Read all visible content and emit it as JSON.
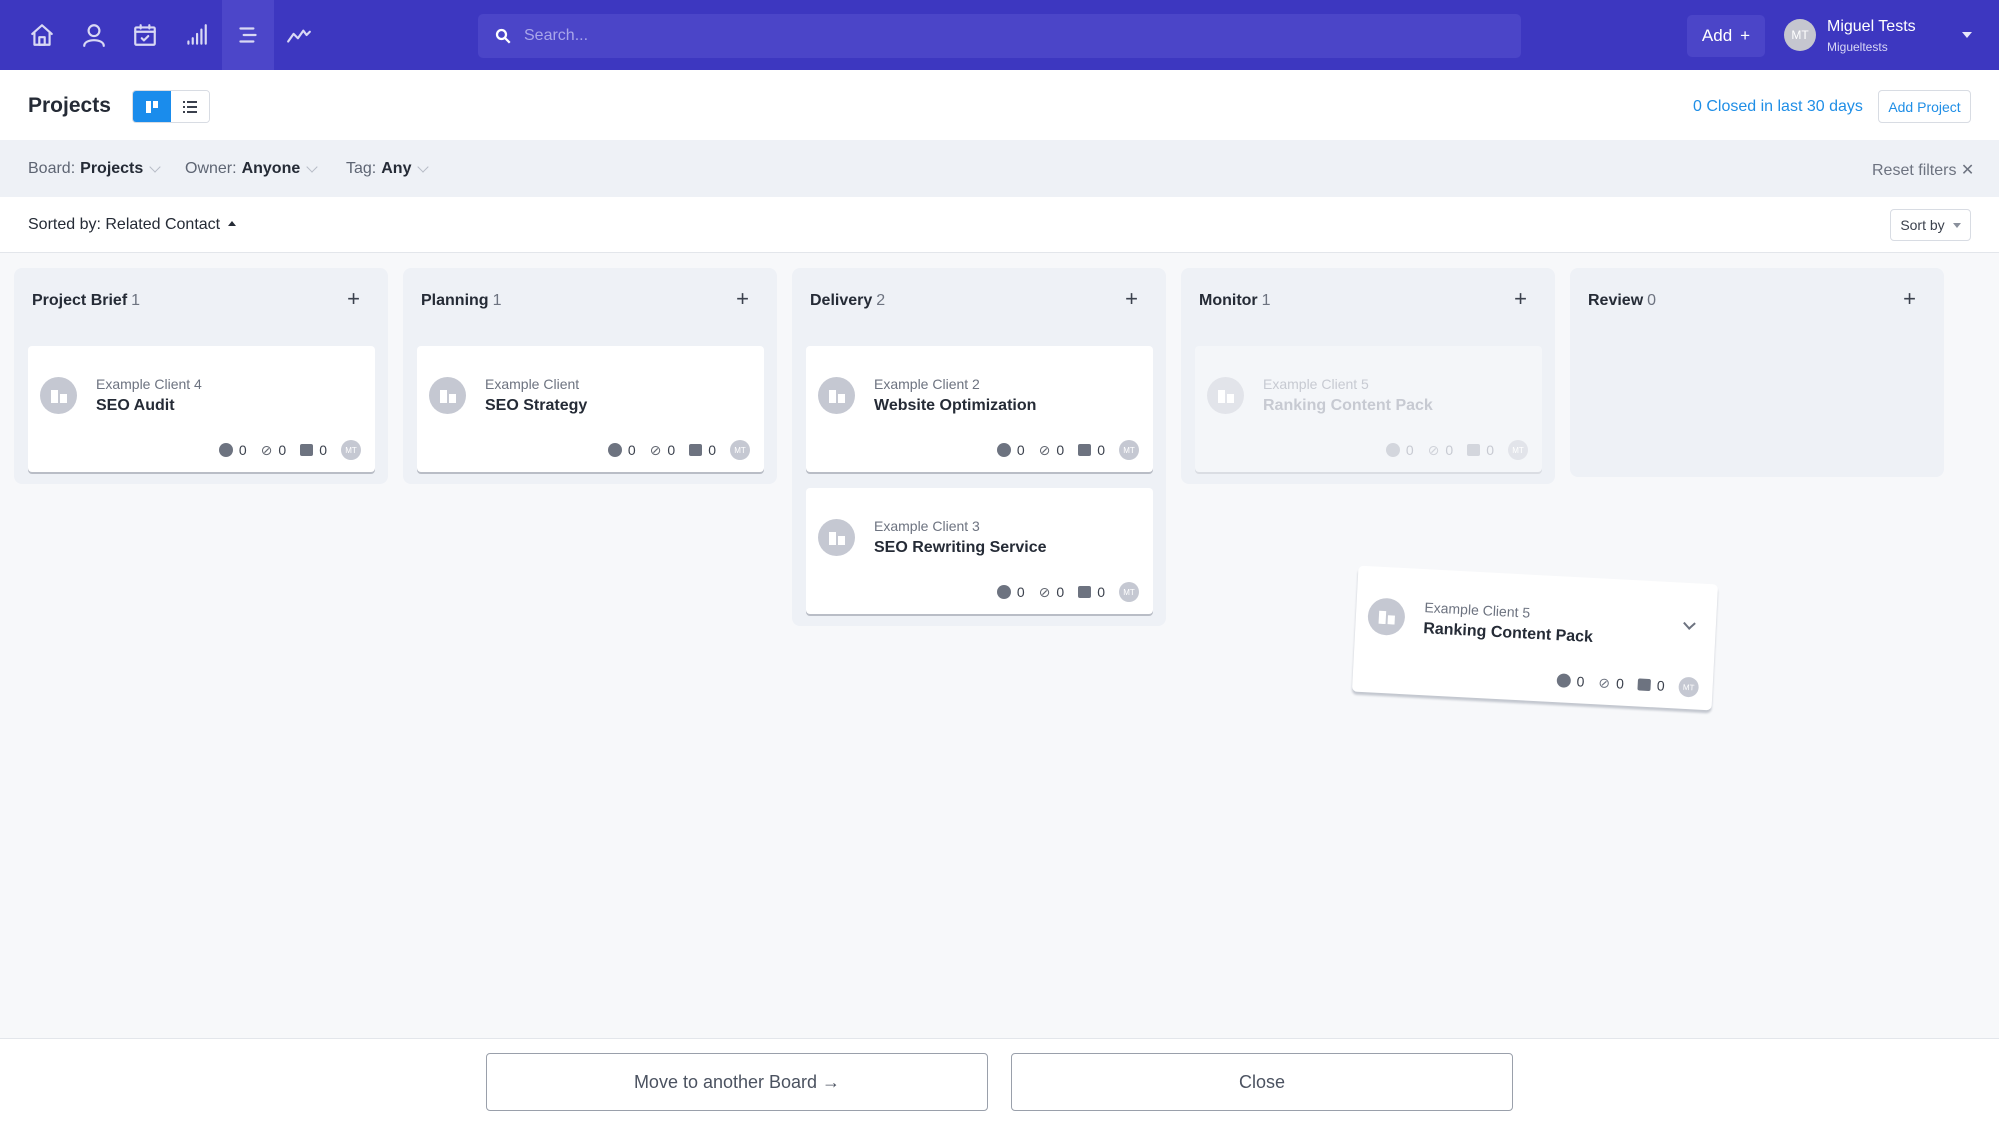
{
  "nav": {
    "icons": [
      "home-icon",
      "contacts-icon",
      "calendar-icon",
      "reports-icon",
      "projects-icon",
      "activity-icon"
    ],
    "active_index": 4,
    "search_placeholder": "Search...",
    "add_label": "Add",
    "user": {
      "initials": "MT",
      "name": "Miguel Tests",
      "account": "Migueltests"
    }
  },
  "header": {
    "title": "Projects",
    "closed_link": "0 Closed in last 30 days",
    "add_project_label": "Add Project",
    "view_mode": "board"
  },
  "filters": {
    "board": {
      "label": "Board:",
      "value": "Projects"
    },
    "owner": {
      "label": "Owner:",
      "value": "Anyone"
    },
    "tag": {
      "label": "Tag:",
      "value": "Any"
    },
    "reset_label": "Reset filters ✕"
  },
  "sort": {
    "sorted_by": "Sorted by: Related Contact",
    "sort_by_label": "Sort by"
  },
  "columns": [
    {
      "name": "Project Brief",
      "count": "1",
      "cards": [
        {
          "client": "Example Client 4",
          "title": "SEO Audit",
          "tasks": "0",
          "files": "0",
          "notes": "0",
          "owner": "MT"
        }
      ]
    },
    {
      "name": "Planning",
      "count": "1",
      "cards": [
        {
          "client": "Example Client",
          "title": "SEO Strategy",
          "tasks": "0",
          "files": "0",
          "notes": "0",
          "owner": "MT"
        }
      ]
    },
    {
      "name": "Delivery",
      "count": "2",
      "cards": [
        {
          "client": "Example Client 2",
          "title": "Website Optimization",
          "tasks": "0",
          "files": "0",
          "notes": "0",
          "owner": "MT"
        },
        {
          "client": "Example Client 3",
          "title": "SEO Rewriting Service",
          "tasks": "0",
          "files": "0",
          "notes": "0",
          "owner": "MT"
        }
      ]
    },
    {
      "name": "Monitor",
      "count": "1",
      "cards": [
        {
          "client": "Example Client 5",
          "title": "Ranking Content Pack",
          "tasks": "0",
          "files": "0",
          "notes": "0",
          "owner": "MT",
          "placeholder": true
        }
      ]
    },
    {
      "name": "Review",
      "count": "0",
      "cards": []
    }
  ],
  "dragging_card": {
    "client": "Example Client 5",
    "title": "Ranking Content Pack",
    "tasks": "0",
    "files": "0",
    "notes": "0",
    "owner": "MT"
  },
  "footer": {
    "move_label": "Move to another Board →",
    "close_label": "Close"
  }
}
